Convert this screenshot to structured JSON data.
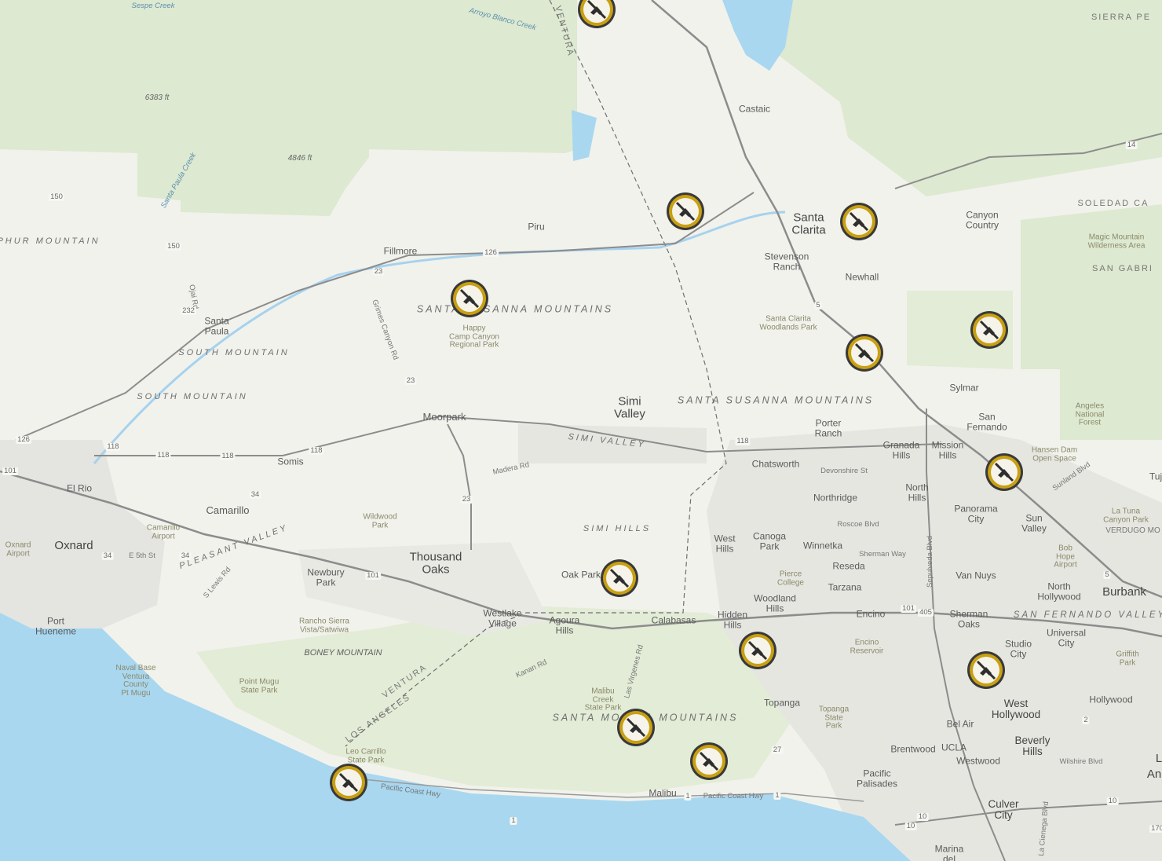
{
  "colors": {
    "ocean": "#a9d7f0",
    "land": "#f1f2ec",
    "forest": "#dce9cf",
    "river": "#9fd0ee",
    "road": "#8a8a8a",
    "marker_ring": "#c8a012"
  },
  "labels": {
    "sierra": "SIERRA PE",
    "soledad": "SOLEDAD CA",
    "san_gabri": "SAN GABRI",
    "sulphur": "PHUR MOUNTAIN",
    "santa_susana_1": "SANTA SUSANNA MOUNTAINS",
    "santa_susana_2": "SANTA SUSANNA MOUNTAINS",
    "south_mtn_1": "SOUTH MOUNTAIN",
    "south_mtn_2": "SOUTH MOUNTAIN",
    "simi_valley_range": "SIMI VALLEY",
    "simi_hills": "SIMI HILLS",
    "pleasant_valley": "PLEASANT VALLEY",
    "santa_monica": "SANTA MONICA MOUNTAINS",
    "sfv": "SAN FERNANDO VALLEY",
    "boney": "BONEY MOUNTAIN",
    "ventura_1": "VENTURA",
    "ventura_2": "VENTURA",
    "los_angeles": "LOS ANGELES",
    "sespe": "Sespe Creek",
    "arroyo": "Arroyo Blanco Creek",
    "santa_paula_creek": "Santa Paula Creek",
    "elev_6383": "6383 ft",
    "elev_4846": "4846 ft",
    "castaic": "Castaic",
    "santa_clarita": "Santa\nClarita",
    "canyon_country": "Canyon\nCountry",
    "stevenson": "Stevenson\nRanch",
    "newhall": "Newhall",
    "magic_mtn": "Magic Mountain\nWilderness Area",
    "sc_woodlands": "Santa Clarita\nWoodlands Park",
    "piru": "Piru",
    "fillmore": "Fillmore",
    "santa_paula": "Santa\nPaula",
    "happy_camp": "Happy\nCamp Canyon\nRegional Park",
    "moorpark": "Moorpark",
    "simi_valley": "Simi\nValley",
    "porter_ranch": "Porter\nRanch",
    "granada_hills": "Granada\nHills",
    "mission_hills": "Mission\nHills",
    "sylmar": "Sylmar",
    "san_fernando": "San\nFernando",
    "angeles_forest": "Angeles\nNational\nForest",
    "hansen": "Hansen Dam\nOpen Space",
    "chatsworth": "Chatsworth",
    "devonshire": "Devonshire St",
    "northridge": "Northridge",
    "north_hills": "North\nHills",
    "panorama": "Panorama\nCity",
    "sun_valley": "Sun\nValley",
    "la_tuna": "La Tuna\nCanyon Park",
    "verdugo": "VERDUGO MO",
    "bob_hope": "Bob\nHope\nAirport",
    "burbank": "Burbank",
    "north_hollywood": "North\nHollywood",
    "van_nuys": "Van Nuys",
    "roscoe": "Roscoe Blvd",
    "sherman_way": "Sherman Way",
    "west_hills": "West\nHills",
    "canoga": "Canoga\nPark",
    "winnetka": "Winnetka",
    "reseda": "Reseda",
    "pierce": "Pierce\nCollege",
    "tarzana": "Tarzana",
    "woodland_hills": "Woodland\nHills",
    "encino": "Encino",
    "encino_res": "Encino\nReservoir",
    "sherman_oaks": "Sherman\nOaks",
    "studio_city": "Studio\nCity",
    "universal": "Universal\nCity",
    "griffith": "Griffith\nPark",
    "somis": "Somis",
    "el_rio": "El Rio",
    "camarillo": "Camarillo",
    "camarillo_airport": "Camarillo\nAirport",
    "oxnard": "Oxnard",
    "oxnard_airport": "Oxnard\nAirport",
    "e5th": "E 5th St",
    "port_hueneme": "Port\nHueneme",
    "naval_base": "Naval Base\nVentura\nCounty\nPt Mugu",
    "wildwood": "Wildwood\nPark",
    "thousand_oaks": "Thousand\nOaks",
    "newbury": "Newbury\nPark",
    "oak_park": "Oak Park",
    "westlake": "Westlake\nVillage",
    "agoura": "Agoura\nHills",
    "calabasas": "Calabasas",
    "hidden_hills": "Hidden\nHills",
    "rancho_sierra": "Rancho Sierra\nVista/Satwiwa",
    "point_mugu": "Point Mugu\nState Park",
    "leo_carrillo": "Leo Carrillo\nState Park",
    "malibu_creek": "Malibu\nCreek\nState Park",
    "topanga": "Topanga",
    "topanga_sp": "Topanga\nState\nPark",
    "malibu": "Malibu",
    "pch_1": "Pacific Coast Hwy",
    "pch_2": "Pacific Coast Hwy",
    "pacific_palisades": "Pacific\nPalisades",
    "brentwood": "Brentwood",
    "ucla": "UCLA",
    "bel_air": "Bel Air",
    "westwood": "Westwood",
    "beverly_hills": "Beverly\nHills",
    "west_hollywood": "West\nHollywood",
    "hollywood": "Hollywood",
    "wilshire": "Wilshire Blvd",
    "culver_city": "Culver\nCity",
    "marina": "Marina\ndel",
    "an": "An",
    "l": "L",
    "tuj": "Tuj",
    "madera": "Madera Rd",
    "grimes": "Grimes Canyon Rd",
    "kanan": "Kanan Rd",
    "las_virgenes": "Las Virgenes Rd",
    "sepulveda": "Sepulveda Blvd",
    "lewis": "S Lewis Rd",
    "ojai": "Ojai Rd",
    "sunland": "Sunland Blvd",
    "la_cienega": "La Cienega Blvd"
  },
  "shields": {
    "h126a": "126",
    "h126b": "126",
    "h150a": "150",
    "h150b": "150",
    "h23a": "23",
    "h23b": "23",
    "h23c": "23",
    "h118a": "118",
    "h118b": "118",
    "h118c": "118",
    "h118d": "118",
    "h118e": "118",
    "h101a": "101",
    "h101b": "101",
    "h101c": "101",
    "h34a": "34",
    "h34b": "34",
    "h34c": "34",
    "h5a": "5",
    "h5b": "5",
    "h405": "405",
    "h14": "14",
    "h1a": "1",
    "h1b": "1",
    "h1c": "1",
    "h27": "27",
    "h2": "2",
    "h10a": "10",
    "h10b": "10",
    "h10c": "10",
    "h232": "232",
    "h170": "170"
  },
  "markers": [
    {
      "name": "Sespe region fire incident"
    },
    {
      "name": "Castaic area fire incident"
    },
    {
      "name": "Santa Clarita fire incident"
    },
    {
      "name": "Fillmore area fire incident"
    },
    {
      "name": "Angeles Forest fire incident"
    },
    {
      "name": "Newhall Pass fire incident"
    },
    {
      "name": "San Fernando fire incident"
    },
    {
      "name": "Oak Park fire incident"
    },
    {
      "name": "Topanga area fire incident"
    },
    {
      "name": "Studio City fire incident"
    },
    {
      "name": "Malibu Creek fire incident"
    },
    {
      "name": "Malibu fire incident"
    },
    {
      "name": "Leo Carrillo fire incident"
    }
  ]
}
